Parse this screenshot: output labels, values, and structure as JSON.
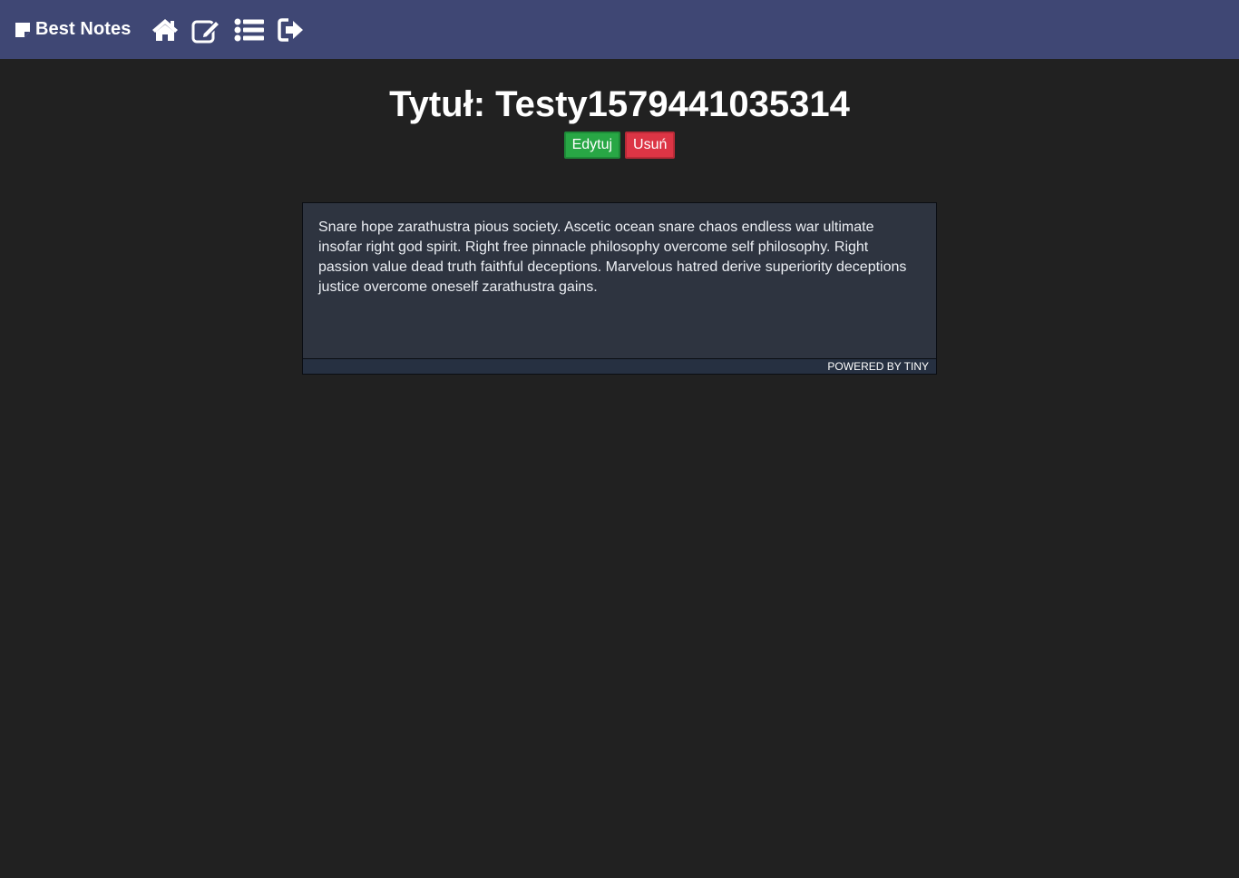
{
  "navbar": {
    "brand_icon": "note-icon",
    "brand_label": "Best Notes",
    "icons": [
      "home-icon",
      "edit-note-icon",
      "list-icon",
      "logout-icon"
    ],
    "background": "#3f4774"
  },
  "note": {
    "title": "Tytuł: Testy1579441035314",
    "edit_label": "Edytuj",
    "delete_label": "Usuń",
    "body": "Snare hope zarathustra pious society. Ascetic ocean snare chaos endless war ultimate insofar right god spirit. Right free pinnacle philosophy overcome self philosophy. Right passion value dead truth faithful deceptions. Marvelous hatred derive superiority deceptions justice overcome oneself zarathustra gains.",
    "powered_by": "POWERED BY TINY"
  },
  "colors": {
    "page_background": "#212121",
    "edit_button": "#28a745",
    "delete_button": "#dc3545",
    "editor_background": "#2e3440"
  }
}
